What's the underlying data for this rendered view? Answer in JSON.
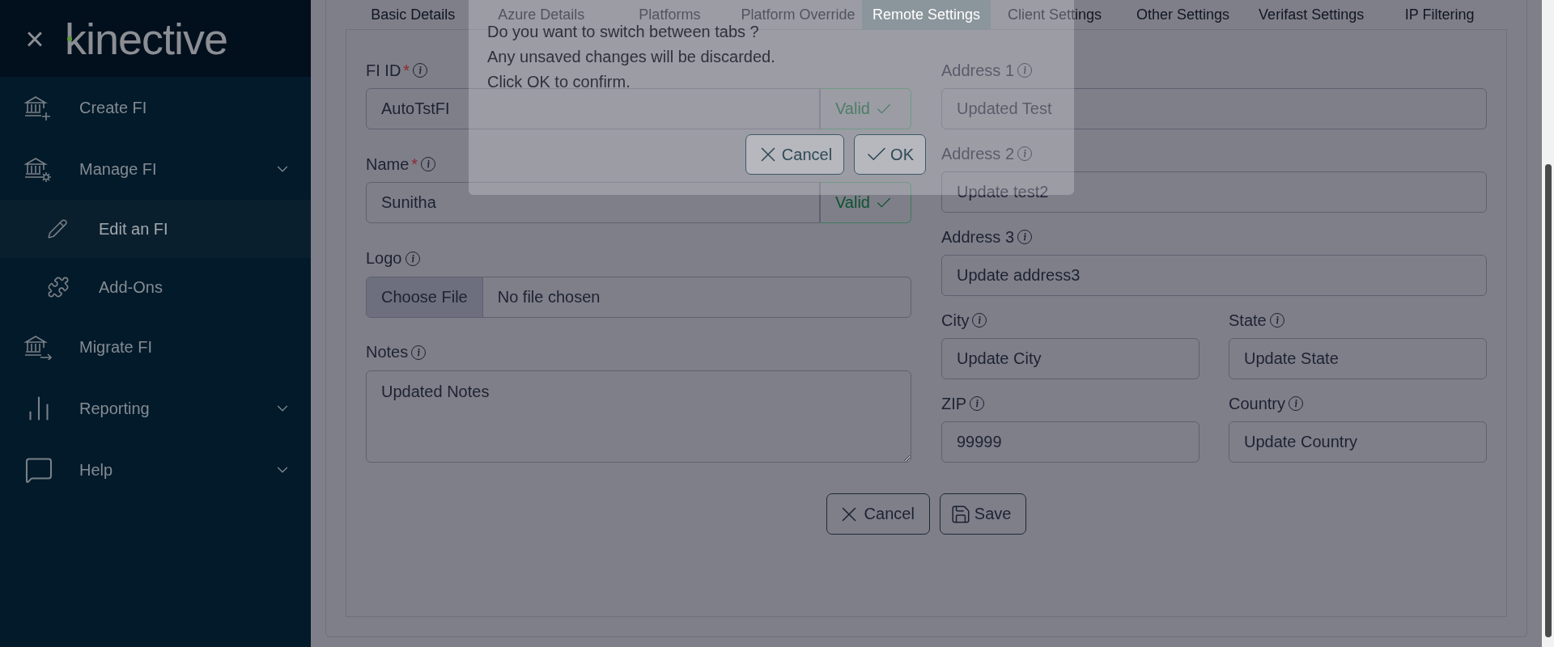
{
  "sidebar": {
    "logo": "kinective",
    "close": "×",
    "items": [
      {
        "label": "Create FI",
        "kind": "link",
        "selected": false
      },
      {
        "label": "Manage FI",
        "kind": "group",
        "selected": false,
        "children": [
          {
            "label": "Edit an FI",
            "selected": true
          },
          {
            "label": "Add-Ons",
            "selected": false
          }
        ]
      },
      {
        "label": "Migrate FI",
        "kind": "link",
        "selected": false
      },
      {
        "label": "Reporting",
        "kind": "group",
        "selected": false
      },
      {
        "label": "Help",
        "kind": "group",
        "selected": false
      }
    ]
  },
  "tabs": [
    {
      "label": "Basic Details",
      "selected": false
    },
    {
      "label": "Azure Details",
      "selected": false
    },
    {
      "label": "Platforms",
      "selected": false
    },
    {
      "label": "Platform Override",
      "selected": false
    },
    {
      "label": "Remote Settings",
      "selected": true
    },
    {
      "label": "Client Settings",
      "selected": false
    },
    {
      "label": "Other Settings",
      "selected": false
    },
    {
      "label": "Verifast Settings",
      "selected": false
    },
    {
      "label": "IP Filtering",
      "selected": false
    }
  ],
  "form": {
    "left": [
      {
        "label": "FI ID",
        "required_mark": "*",
        "kind": "text",
        "value": "AutoTstFI",
        "validation": "Valid"
      },
      {
        "label": "Name",
        "required_mark": "*",
        "kind": "text",
        "value": "Sunitha",
        "validation": "Valid"
      },
      {
        "label": "Logo",
        "kind": "file",
        "button": "Choose File",
        "value": "No file chosen"
      },
      {
        "label": "Notes",
        "kind": "textarea",
        "value": "Updated Notes"
      }
    ],
    "right": [
      [
        {
          "label": "Address 1",
          "value": "Updated Test"
        }
      ],
      [
        {
          "label": "Address 2",
          "value": "Update test2"
        }
      ],
      [
        {
          "label": "Address 3",
          "value": "Update address3"
        }
      ],
      [
        {
          "label": "City",
          "value": "Update City"
        },
        {
          "label": "State",
          "value": "Update State"
        }
      ],
      [
        {
          "label": "ZIP",
          "value": "99999"
        },
        {
          "label": "Country",
          "value": "Update Country"
        }
      ]
    ],
    "buttons": [
      {
        "label": "Cancel",
        "kind": "cancel"
      },
      {
        "label": "Save",
        "kind": "save"
      }
    ]
  },
  "dialog": {
    "lines": [
      "Do you want to switch between tabs ?",
      "Any unsaved changes will be discarded.",
      "Click OK to confirm."
    ],
    "buttons": [
      {
        "label": "Cancel",
        "kind": "cancel"
      },
      {
        "label": "OK",
        "kind": "ok"
      }
    ]
  }
}
